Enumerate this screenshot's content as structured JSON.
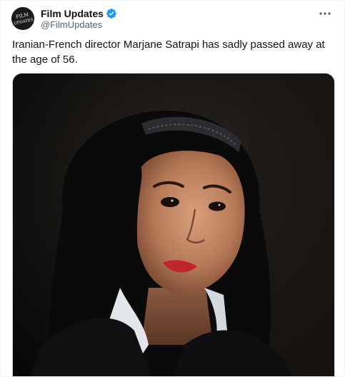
{
  "author": {
    "display_name": "Film Updates",
    "handle": "@FilmUpdates",
    "avatar_text": "FILM UPDATES",
    "verified": true,
    "verified_color": "#1d9bf0"
  },
  "tweet": {
    "text": "Iranian-French director Marjane Satrapi has sadly passed away at the age of 56."
  },
  "icons": {
    "more": "more-horizontal-icon",
    "verified": "verified-badge-icon"
  }
}
